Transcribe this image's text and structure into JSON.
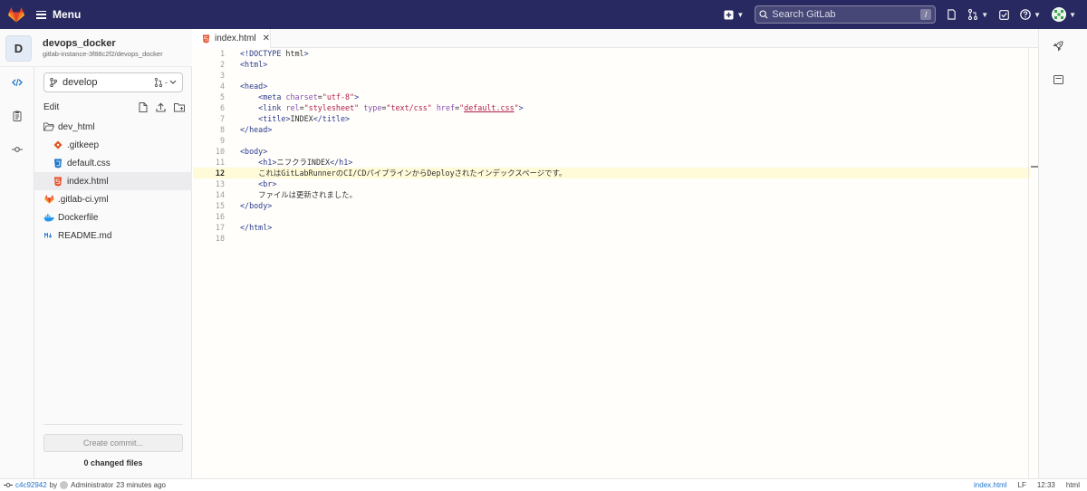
{
  "topbar": {
    "menu_label": "Menu",
    "search_placeholder": "Search GitLab",
    "search_shortcut": "/"
  },
  "project": {
    "avatar_letter": "D",
    "name": "devops_docker",
    "path": "gitlab-instance-3f88c2f2/devops_docker"
  },
  "branch": {
    "name": "develop"
  },
  "filepanel": {
    "edit_label": "Edit",
    "items": [
      {
        "name": "dev_html",
        "type": "folder"
      },
      {
        "name": ".gitkeep",
        "type": "gitkeep"
      },
      {
        "name": "default.css",
        "type": "css"
      },
      {
        "name": "index.html",
        "type": "html"
      },
      {
        "name": ".gitlab-ci.yml",
        "type": "gitlab"
      },
      {
        "name": "Dockerfile",
        "type": "docker"
      },
      {
        "name": "README.md",
        "type": "markdown"
      }
    ],
    "commit_button": "Create commit...",
    "changed_files": "0 changed files"
  },
  "editor": {
    "tab_label": "index.html",
    "current_line": 12,
    "lines": [
      "<!DOCTYPE html>",
      "<html>",
      "",
      "<head>",
      "    <meta charset=\"utf-8\">",
      "    <link rel=\"stylesheet\" type=\"text/css\" href=\"default.css\">",
      "    <title>INDEX</title>",
      "</head>",
      "",
      "<body>",
      "    <h1>ニフクラINDEX</h1>",
      "    これはGitLabRunnerのCI/CDパイプラインからDeployされたインデックスページです。",
      "    <br>",
      "    ファイルは更新されました。",
      "</body>",
      "",
      "</html>",
      ""
    ]
  },
  "status": {
    "commit_sha": "c4c92942",
    "by_label": "by",
    "author": "Administrator",
    "time_ago": "23 minutes ago",
    "language": "index.html",
    "eol": "LF",
    "cursor_pos": "12:33",
    "mode": "html"
  },
  "colors": {
    "navbar": "#292961",
    "current_line": "#fffad8",
    "link": "#1f75cb"
  }
}
